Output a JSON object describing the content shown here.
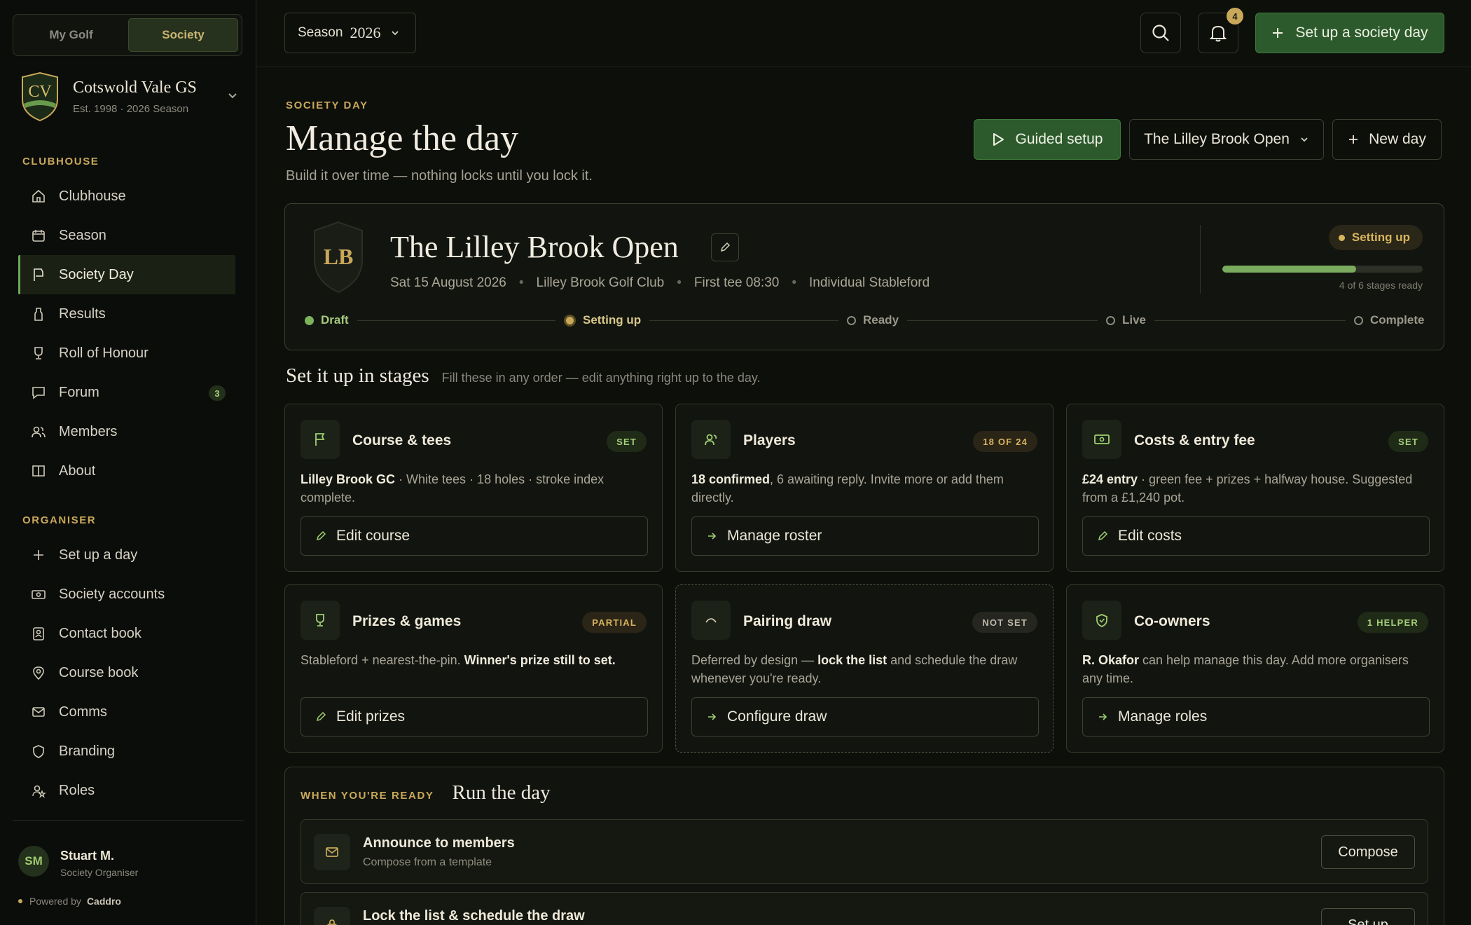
{
  "mode_toggle": {
    "my_golf": "My Golf",
    "society": "Society"
  },
  "society": {
    "crest_initials": "CV",
    "name": "Cotswold Vale GS",
    "subtitle": "Est. 1998 · 2026 Season"
  },
  "sidebar": {
    "clubhouse_label": "CLUBHOUSE",
    "clubhouse_items": [
      {
        "label": "Clubhouse",
        "icon": "home-icon"
      },
      {
        "label": "Season",
        "icon": "calendar-icon"
      },
      {
        "label": "Society Day",
        "icon": "flag-icon",
        "active": true
      },
      {
        "label": "Results",
        "icon": "bottle-icon"
      },
      {
        "label": "Roll of Honour",
        "icon": "trophy-icon"
      },
      {
        "label": "Forum",
        "icon": "chat-icon",
        "badge": "3"
      },
      {
        "label": "Members",
        "icon": "users-icon"
      },
      {
        "label": "About",
        "icon": "book-icon"
      }
    ],
    "organiser_label": "ORGANISER",
    "organiser_items": [
      {
        "label": "Set up a day",
        "icon": "plus-icon"
      },
      {
        "label": "Society accounts",
        "icon": "money-icon"
      },
      {
        "label": "Contact book",
        "icon": "contact-icon"
      },
      {
        "label": "Course book",
        "icon": "pin-icon"
      },
      {
        "label": "Comms",
        "icon": "mail-icon"
      },
      {
        "label": "Branding",
        "icon": "shield-icon"
      },
      {
        "label": "Roles",
        "icon": "user-star-icon"
      }
    ]
  },
  "user": {
    "initials": "SM",
    "name": "Stuart M.",
    "role": "Society Organiser"
  },
  "powered": {
    "label": "Powered by",
    "brand": "Caddro"
  },
  "topbar": {
    "season_label": "Season",
    "season_year": "2026",
    "notification_count": "4",
    "setup_button": "Set up a society day"
  },
  "page": {
    "eyebrow": "SOCIETY DAY",
    "title": "Manage the day",
    "subtitle": "Build it over time — nothing locks until you lock it.",
    "guided_setup": "Guided setup",
    "event_select": "The Lilley Brook Open",
    "new_day": "New day"
  },
  "event": {
    "crest_initials": "LB",
    "title": "The Lilley Brook Open",
    "date": "Sat 15 August 2026",
    "club": "Lilley Brook Golf Club",
    "first_tee": "First tee 08:30",
    "format": "Individual Stableford",
    "status": "Setting up",
    "progress_fraction": 0.667,
    "progress_label": "4 of 6 stages ready",
    "steps": [
      "Draft",
      "Setting up",
      "Ready",
      "Live",
      "Complete"
    ]
  },
  "stages": {
    "title": "Set it up in stages",
    "subtitle": "Fill these in any order — edit anything right up to the day.",
    "cards": [
      {
        "title": "Course & tees",
        "badge": "SET",
        "body_bold": "Lilley Brook GC",
        "body": " · White tees · 18 holes · stroke index complete.",
        "button": "Edit course"
      },
      {
        "title": "Players",
        "badge": "18 OF 24",
        "body_bold": "18 confirmed",
        "body": ", 6 awaiting reply. Invite more or add them directly.",
        "button": "Manage roster"
      },
      {
        "title": "Costs & entry fee",
        "badge": "SET",
        "body_bold": "£24 entry",
        "body": " · green fee + prizes + halfway house. Suggested from a £1,240 pot.",
        "button": "Edit costs"
      },
      {
        "title": "Prizes & games",
        "badge": "PARTIAL",
        "body": "Stableford + nearest-the-pin. ",
        "body_bold": "Winner's prize still to set.",
        "button": "Edit prizes"
      },
      {
        "title": "Pairing draw",
        "badge": "NOT SET",
        "body": "Deferred by design — ",
        "body_bold": "lock the list",
        "body_after": " and schedule the draw whenever you're ready.",
        "button": "Configure draw"
      },
      {
        "title": "Co-owners",
        "badge": "1 HELPER",
        "body_bold": "R. Okafor",
        "body": " can help manage this day. Add more organisers any time.",
        "button": "Manage roles"
      }
    ]
  },
  "run_day": {
    "eyebrow": "WHEN YOU'RE READY",
    "title": "Run the day",
    "rows": [
      {
        "title": "Announce to members",
        "subtitle": "Compose from a template",
        "button": "Compose"
      },
      {
        "title": "Lock the list & schedule the draw",
        "button": "Set up"
      }
    ]
  }
}
